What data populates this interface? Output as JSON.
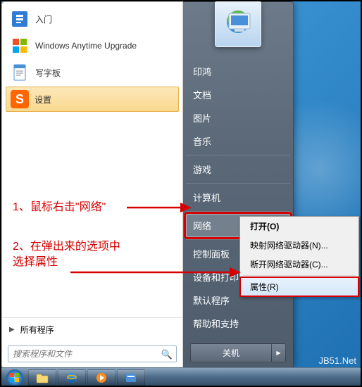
{
  "programs": [
    {
      "label": "入门",
      "icon_name": "getting-started-icon",
      "icon_glyph": "📘",
      "icon_color": ""
    },
    {
      "label": "Windows Anytime Upgrade",
      "icon_name": "windows-upgrade-icon",
      "icon_glyph": "⊞",
      "icon_color": "#2e7cd6"
    },
    {
      "label": "写字板",
      "icon_name": "wordpad-icon",
      "icon_glyph": "📄",
      "icon_color": ""
    },
    {
      "label": "设置",
      "icon_name": "sogou-settings-icon",
      "icon_glyph": "S",
      "icon_color": "#fff",
      "highlighted": true
    }
  ],
  "all_programs_label": "所有程序",
  "search_placeholder": "搜索程序和文件",
  "right_items": [
    {
      "label": "印鸿",
      "name": "user-name-item"
    },
    {
      "label": "文档",
      "name": "documents-item"
    },
    {
      "label": "图片",
      "name": "pictures-item"
    },
    {
      "label": "音乐",
      "name": "music-item"
    },
    {
      "label": "游戏",
      "name": "games-item"
    },
    {
      "label": "计算机",
      "name": "computer-item"
    }
  ],
  "network_label": "网络",
  "right_items2": [
    {
      "label": "控制面板",
      "name": "control-panel-item"
    },
    {
      "label": "设备和打印机",
      "name": "devices-item"
    },
    {
      "label": "默认程序",
      "name": "default-programs-item"
    },
    {
      "label": "帮助和支持",
      "name": "help-item"
    }
  ],
  "shutdown_label": "关机",
  "context_menu": {
    "open": "打开(O)",
    "map": "映射网络驱动器(N)...",
    "disconnect": "断开网络驱动器(C)...",
    "properties": "属性(R)"
  },
  "annotations": {
    "step1": "1、鼠标右击\"网络\"",
    "step2_line1": "2、在弹出来的选项中",
    "step2_line2": "选择属性"
  },
  "watermark": "JB51.Net",
  "colors": {
    "red": "#d40000"
  }
}
